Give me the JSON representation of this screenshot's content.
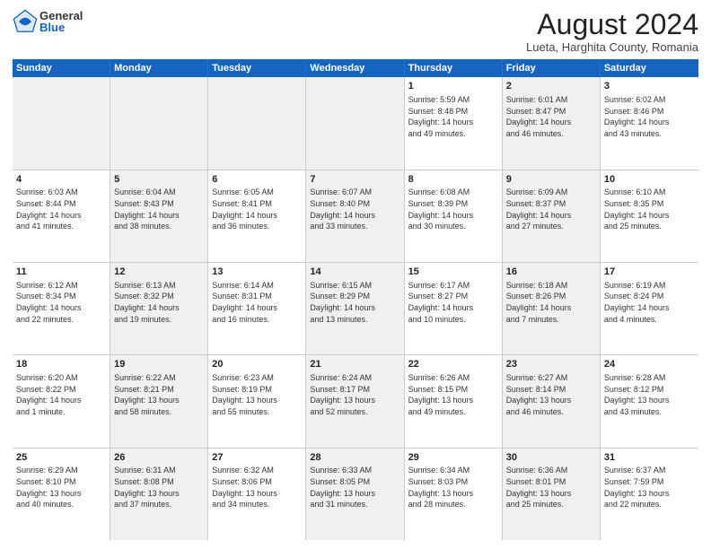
{
  "logo": {
    "general": "General",
    "blue": "Blue"
  },
  "title": "August 2024",
  "location": "Lueta, Harghita County, Romania",
  "days_of_week": [
    "Sunday",
    "Monday",
    "Tuesday",
    "Wednesday",
    "Thursday",
    "Friday",
    "Saturday"
  ],
  "weeks": [
    [
      {
        "day": "",
        "info": "",
        "shaded": true
      },
      {
        "day": "",
        "info": "",
        "shaded": true
      },
      {
        "day": "",
        "info": "",
        "shaded": true
      },
      {
        "day": "",
        "info": "",
        "shaded": true
      },
      {
        "day": "1",
        "info": "Sunrise: 5:59 AM\nSunset: 8:48 PM\nDaylight: 14 hours\nand 49 minutes."
      },
      {
        "day": "2",
        "info": "Sunrise: 6:01 AM\nSunset: 8:47 PM\nDaylight: 14 hours\nand 46 minutes.",
        "shaded": true
      },
      {
        "day": "3",
        "info": "Sunrise: 6:02 AM\nSunset: 8:46 PM\nDaylight: 14 hours\nand 43 minutes."
      }
    ],
    [
      {
        "day": "4",
        "info": "Sunrise: 6:03 AM\nSunset: 8:44 PM\nDaylight: 14 hours\nand 41 minutes."
      },
      {
        "day": "5",
        "info": "Sunrise: 6:04 AM\nSunset: 8:43 PM\nDaylight: 14 hours\nand 38 minutes.",
        "shaded": true
      },
      {
        "day": "6",
        "info": "Sunrise: 6:05 AM\nSunset: 8:41 PM\nDaylight: 14 hours\nand 36 minutes."
      },
      {
        "day": "7",
        "info": "Sunrise: 6:07 AM\nSunset: 8:40 PM\nDaylight: 14 hours\nand 33 minutes.",
        "shaded": true
      },
      {
        "day": "8",
        "info": "Sunrise: 6:08 AM\nSunset: 8:39 PM\nDaylight: 14 hours\nand 30 minutes."
      },
      {
        "day": "9",
        "info": "Sunrise: 6:09 AM\nSunset: 8:37 PM\nDaylight: 14 hours\nand 27 minutes.",
        "shaded": true
      },
      {
        "day": "10",
        "info": "Sunrise: 6:10 AM\nSunset: 8:35 PM\nDaylight: 14 hours\nand 25 minutes."
      }
    ],
    [
      {
        "day": "11",
        "info": "Sunrise: 6:12 AM\nSunset: 8:34 PM\nDaylight: 14 hours\nand 22 minutes."
      },
      {
        "day": "12",
        "info": "Sunrise: 6:13 AM\nSunset: 8:32 PM\nDaylight: 14 hours\nand 19 minutes.",
        "shaded": true
      },
      {
        "day": "13",
        "info": "Sunrise: 6:14 AM\nSunset: 8:31 PM\nDaylight: 14 hours\nand 16 minutes."
      },
      {
        "day": "14",
        "info": "Sunrise: 6:15 AM\nSunset: 8:29 PM\nDaylight: 14 hours\nand 13 minutes.",
        "shaded": true
      },
      {
        "day": "15",
        "info": "Sunrise: 6:17 AM\nSunset: 8:27 PM\nDaylight: 14 hours\nand 10 minutes."
      },
      {
        "day": "16",
        "info": "Sunrise: 6:18 AM\nSunset: 8:26 PM\nDaylight: 14 hours\nand 7 minutes.",
        "shaded": true
      },
      {
        "day": "17",
        "info": "Sunrise: 6:19 AM\nSunset: 8:24 PM\nDaylight: 14 hours\nand 4 minutes."
      }
    ],
    [
      {
        "day": "18",
        "info": "Sunrise: 6:20 AM\nSunset: 8:22 PM\nDaylight: 14 hours\nand 1 minute."
      },
      {
        "day": "19",
        "info": "Sunrise: 6:22 AM\nSunset: 8:21 PM\nDaylight: 13 hours\nand 58 minutes.",
        "shaded": true
      },
      {
        "day": "20",
        "info": "Sunrise: 6:23 AM\nSunset: 8:19 PM\nDaylight: 13 hours\nand 55 minutes."
      },
      {
        "day": "21",
        "info": "Sunrise: 6:24 AM\nSunset: 8:17 PM\nDaylight: 13 hours\nand 52 minutes.",
        "shaded": true
      },
      {
        "day": "22",
        "info": "Sunrise: 6:26 AM\nSunset: 8:15 PM\nDaylight: 13 hours\nand 49 minutes."
      },
      {
        "day": "23",
        "info": "Sunrise: 6:27 AM\nSunset: 8:14 PM\nDaylight: 13 hours\nand 46 minutes.",
        "shaded": true
      },
      {
        "day": "24",
        "info": "Sunrise: 6:28 AM\nSunset: 8:12 PM\nDaylight: 13 hours\nand 43 minutes."
      }
    ],
    [
      {
        "day": "25",
        "info": "Sunrise: 6:29 AM\nSunset: 8:10 PM\nDaylight: 13 hours\nand 40 minutes."
      },
      {
        "day": "26",
        "info": "Sunrise: 6:31 AM\nSunset: 8:08 PM\nDaylight: 13 hours\nand 37 minutes.",
        "shaded": true
      },
      {
        "day": "27",
        "info": "Sunrise: 6:32 AM\nSunset: 8:06 PM\nDaylight: 13 hours\nand 34 minutes."
      },
      {
        "day": "28",
        "info": "Sunrise: 6:33 AM\nSunset: 8:05 PM\nDaylight: 13 hours\nand 31 minutes.",
        "shaded": true
      },
      {
        "day": "29",
        "info": "Sunrise: 6:34 AM\nSunset: 8:03 PM\nDaylight: 13 hours\nand 28 minutes."
      },
      {
        "day": "30",
        "info": "Sunrise: 6:36 AM\nSunset: 8:01 PM\nDaylight: 13 hours\nand 25 minutes.",
        "shaded": true
      },
      {
        "day": "31",
        "info": "Sunrise: 6:37 AM\nSunset: 7:59 PM\nDaylight: 13 hours\nand 22 minutes."
      }
    ]
  ]
}
